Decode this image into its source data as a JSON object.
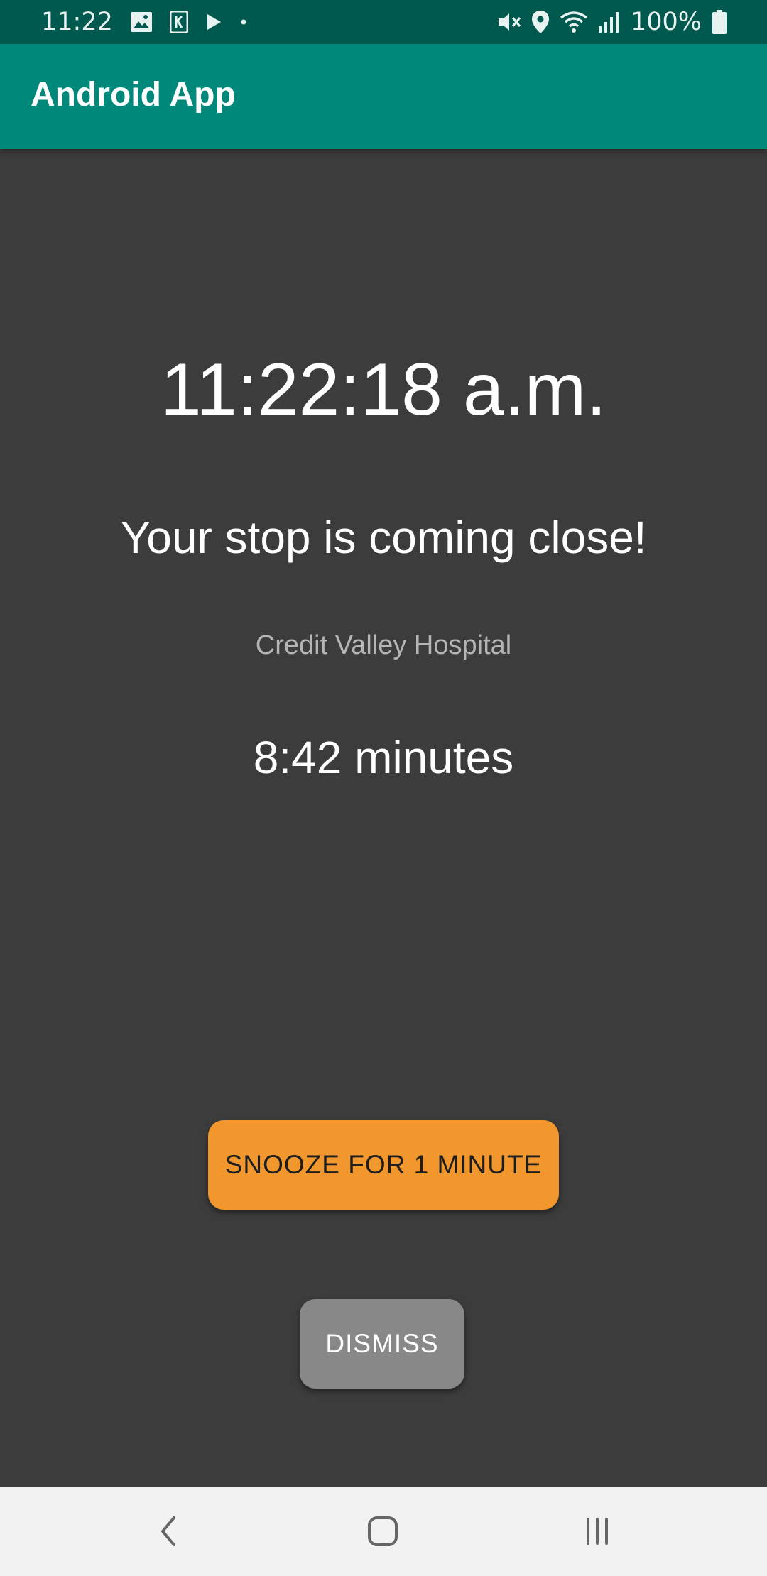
{
  "status_bar": {
    "time": "11:22",
    "battery": "100%",
    "left_icons": [
      "image-icon",
      "k-app-icon",
      "play-icon",
      "dot-icon"
    ],
    "right_icons": [
      "mute-icon",
      "location-icon",
      "wifi-icon",
      "signal-icon",
      "battery-icon"
    ]
  },
  "app_bar": {
    "title": "Android App",
    "color": "#00897b"
  },
  "alarm": {
    "clock": "11:22:18 a.m.",
    "message": "Your stop is coming close!",
    "stop_name": "Credit Valley Hospital",
    "eta": "8:42 minutes"
  },
  "actions": {
    "snooze_label": "SNOOZE FOR 1 MINUTE",
    "snooze_color": "#f2972e",
    "dismiss_label": "DISMISS",
    "dismiss_color": "#888888"
  },
  "nav_bar": {
    "icons": [
      "back-icon",
      "home-icon",
      "recents-icon"
    ]
  }
}
